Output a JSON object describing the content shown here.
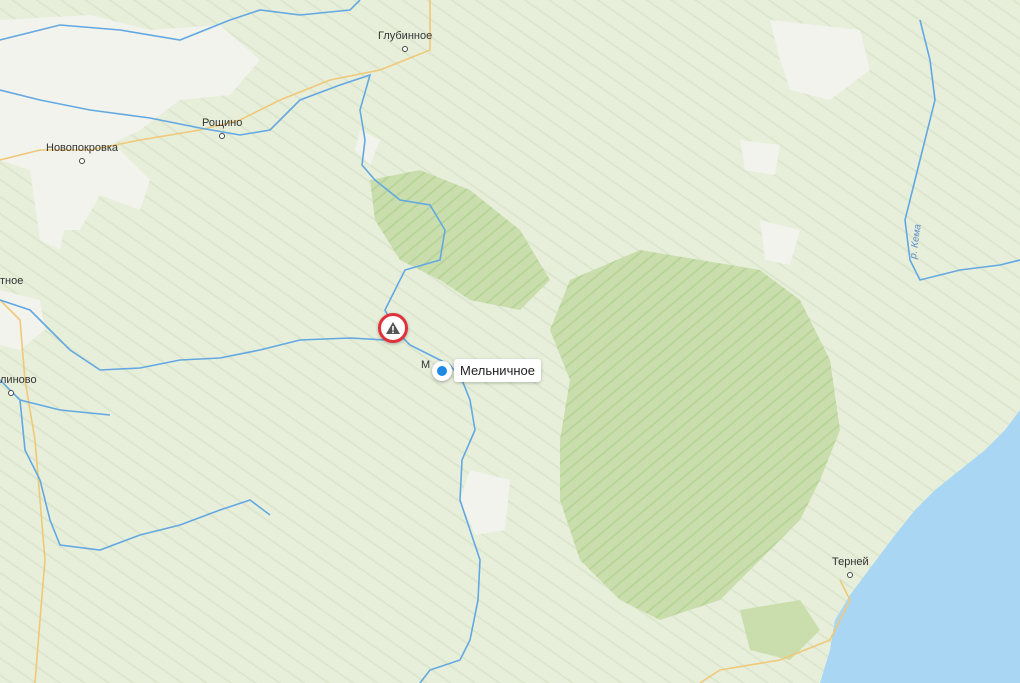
{
  "map": {
    "colors": {
      "land": "#e7efdb",
      "forest": "#c9deac",
      "forest_dark": "#b5d393",
      "settlement": "#f4f3ef",
      "water": "#a9d6f3",
      "river": "#63a8e2",
      "road": "#f0c878",
      "pin": "#1e88e5",
      "warning": "#e0323a"
    },
    "places": {
      "glubinnoe": "Глубинное",
      "roshchino": "Рощино",
      "novopokrovka": "Новопокровка",
      "west_partial": "тное",
      "southwest_partial": "линово",
      "terney": "Терней"
    },
    "river_label": "р. Кема",
    "selected_place": {
      "label": "Мельничное",
      "stub_label": "М"
    },
    "warning_icon": "warning-triangle-icon"
  }
}
